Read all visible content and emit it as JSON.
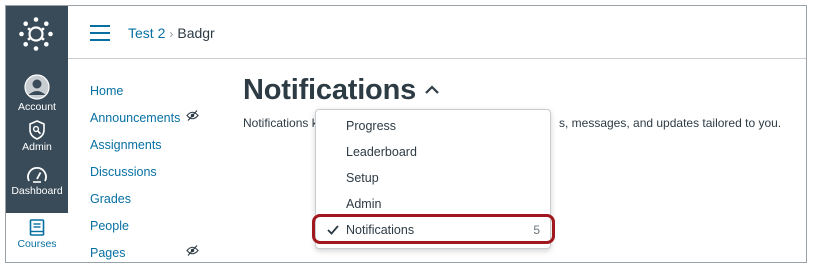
{
  "breadcrumb": {
    "course": "Test 2",
    "separator": "›",
    "current": "Badgr"
  },
  "global_nav": [
    {
      "label": "Account",
      "icon": "account-icon"
    },
    {
      "label": "Admin",
      "icon": "admin-icon"
    },
    {
      "label": "Dashboard",
      "icon": "dashboard-icon"
    },
    {
      "label": "Courses",
      "icon": "courses-icon"
    }
  ],
  "course_nav": [
    {
      "label": "Home"
    },
    {
      "label": "Announcements"
    },
    {
      "label": "Assignments"
    },
    {
      "label": "Discussions"
    },
    {
      "label": "Grades"
    },
    {
      "label": "People"
    },
    {
      "label": "Pages"
    }
  ],
  "page": {
    "title": "Notifications",
    "description_start": "Notifications k",
    "description_end": "s, messages, and updates tailored to you."
  },
  "dropdown": {
    "items": [
      {
        "label": "Progress"
      },
      {
        "label": "Leaderboard"
      },
      {
        "label": "Setup"
      },
      {
        "label": "Admin"
      },
      {
        "label": "Notifications",
        "count": "5",
        "selected": true
      }
    ]
  },
  "colors": {
    "nav_bg": "#394b58",
    "link": "#0770a3",
    "text": "#2d3b45",
    "highlight": "#a0171e"
  }
}
